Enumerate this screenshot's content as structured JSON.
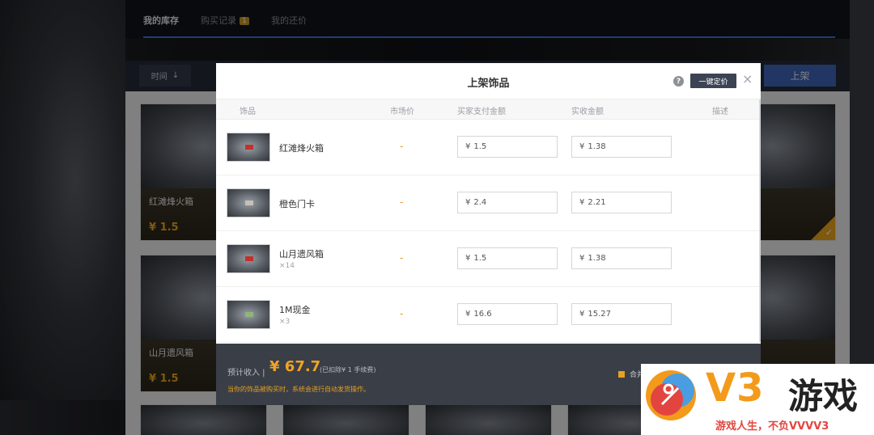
{
  "tabs": [
    {
      "label": "我的库存"
    },
    {
      "label": "购买记录",
      "badge": "1"
    },
    {
      "label": "我的还价"
    }
  ],
  "filter": {
    "sort_label": "时间",
    "sort_icon": "arrow-down-icon",
    "shelf_button": "上架"
  },
  "background_cards": [
    {
      "name": "红滩烽火箱",
      "price": "¥ 1.5"
    },
    {
      "name": "山月遗风箱",
      "price": "¥ 1.5"
    }
  ],
  "modal": {
    "title": "上架饰品",
    "help_icon": "?",
    "auto_price_button": "一键定价",
    "close_icon": "×",
    "columns": [
      "饰品",
      "市场价",
      "买家支付金额",
      "实收金额",
      "描述"
    ],
    "items": [
      {
        "name": "红滩烽火箱",
        "qty": "",
        "market": "-",
        "pay_currency": "¥",
        "pay": "1.5",
        "receive_currency": "¥",
        "receive": "1.38"
      },
      {
        "name": "橙色门卡",
        "qty": "",
        "market": "-",
        "pay_currency": "¥",
        "pay": "2.4",
        "receive_currency": "¥",
        "receive": "2.21"
      },
      {
        "name": "山月遗风箱",
        "qty": "×14",
        "market": "-",
        "pay_currency": "¥",
        "pay": "1.5",
        "receive_currency": "¥",
        "receive": "1.38"
      },
      {
        "name": "1M现金",
        "qty": "×3",
        "market": "-",
        "pay_currency": "¥",
        "pay": "16.6",
        "receive_currency": "¥",
        "receive": "15.27"
      }
    ],
    "footer": {
      "income_label": "预计收入 |",
      "income_amount": "¥ 67.7",
      "fee_note": "(已扣除¥ 1 手续费)",
      "hint": "当你的饰品被购买时，系统会进行自动发货操作。",
      "merge_label": "合并"
    }
  },
  "watermark": {
    "brand": "V3",
    "brand_cn": "游戏",
    "slogan": "游戏人生，不负VVVV3"
  },
  "colors": {
    "accent": "#3d63b2",
    "price": "#f0a323",
    "hint": "#e7a021"
  }
}
